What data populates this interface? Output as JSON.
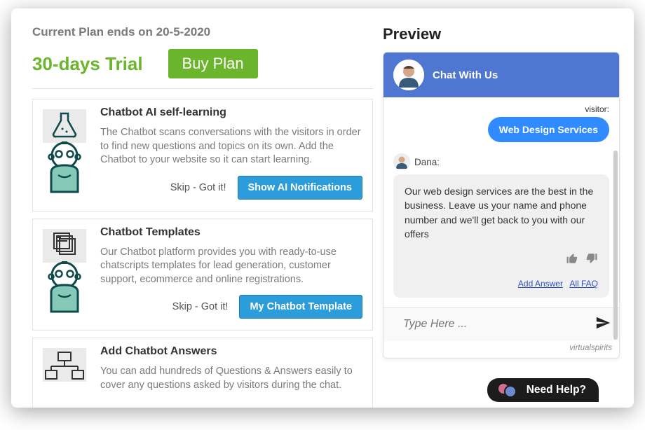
{
  "plan": {
    "ends_label": "Current Plan ends on 20-5-2020",
    "trial_label": "30-days Trial",
    "buy_label": "Buy Plan"
  },
  "cards": [
    {
      "title": "Chatbot AI self-learning",
      "desc": "The Chatbot scans conversations with the visitors in order to find new questions and topics on its own. Add the Chatbot to your website so it can start learning.",
      "skip": "Skip - Got it!",
      "primary": "Show AI Notifications"
    },
    {
      "title": "Chatbot Templates",
      "desc": "Our Chatbot platform provides you with ready-to-use chatscripts templates for lead generation, customer support, ecommerce and online registrations.",
      "skip": "Skip - Got it!",
      "primary": "My Chatbot Template"
    },
    {
      "title": "Add Chatbot Answers",
      "desc": "You can add hundreds of Questions & Answers easily to cover any questions asked by visitors during the chat."
    }
  ],
  "preview": {
    "title": "Preview",
    "header_title": "Chat With Us",
    "visitor_label": "visitor:",
    "visitor_msg": "Web Design Services",
    "agent_name": "Dana:",
    "agent_msg": "Our web design services are the best in the business. Leave us your name and phone number and we'll get back to you with our offers",
    "add_answer": "Add Answer",
    "all_faq": "All FAQ",
    "input_placeholder": "Type Here ...",
    "powered": "virtualspirits"
  },
  "need_help": {
    "label": "Need Help?"
  }
}
